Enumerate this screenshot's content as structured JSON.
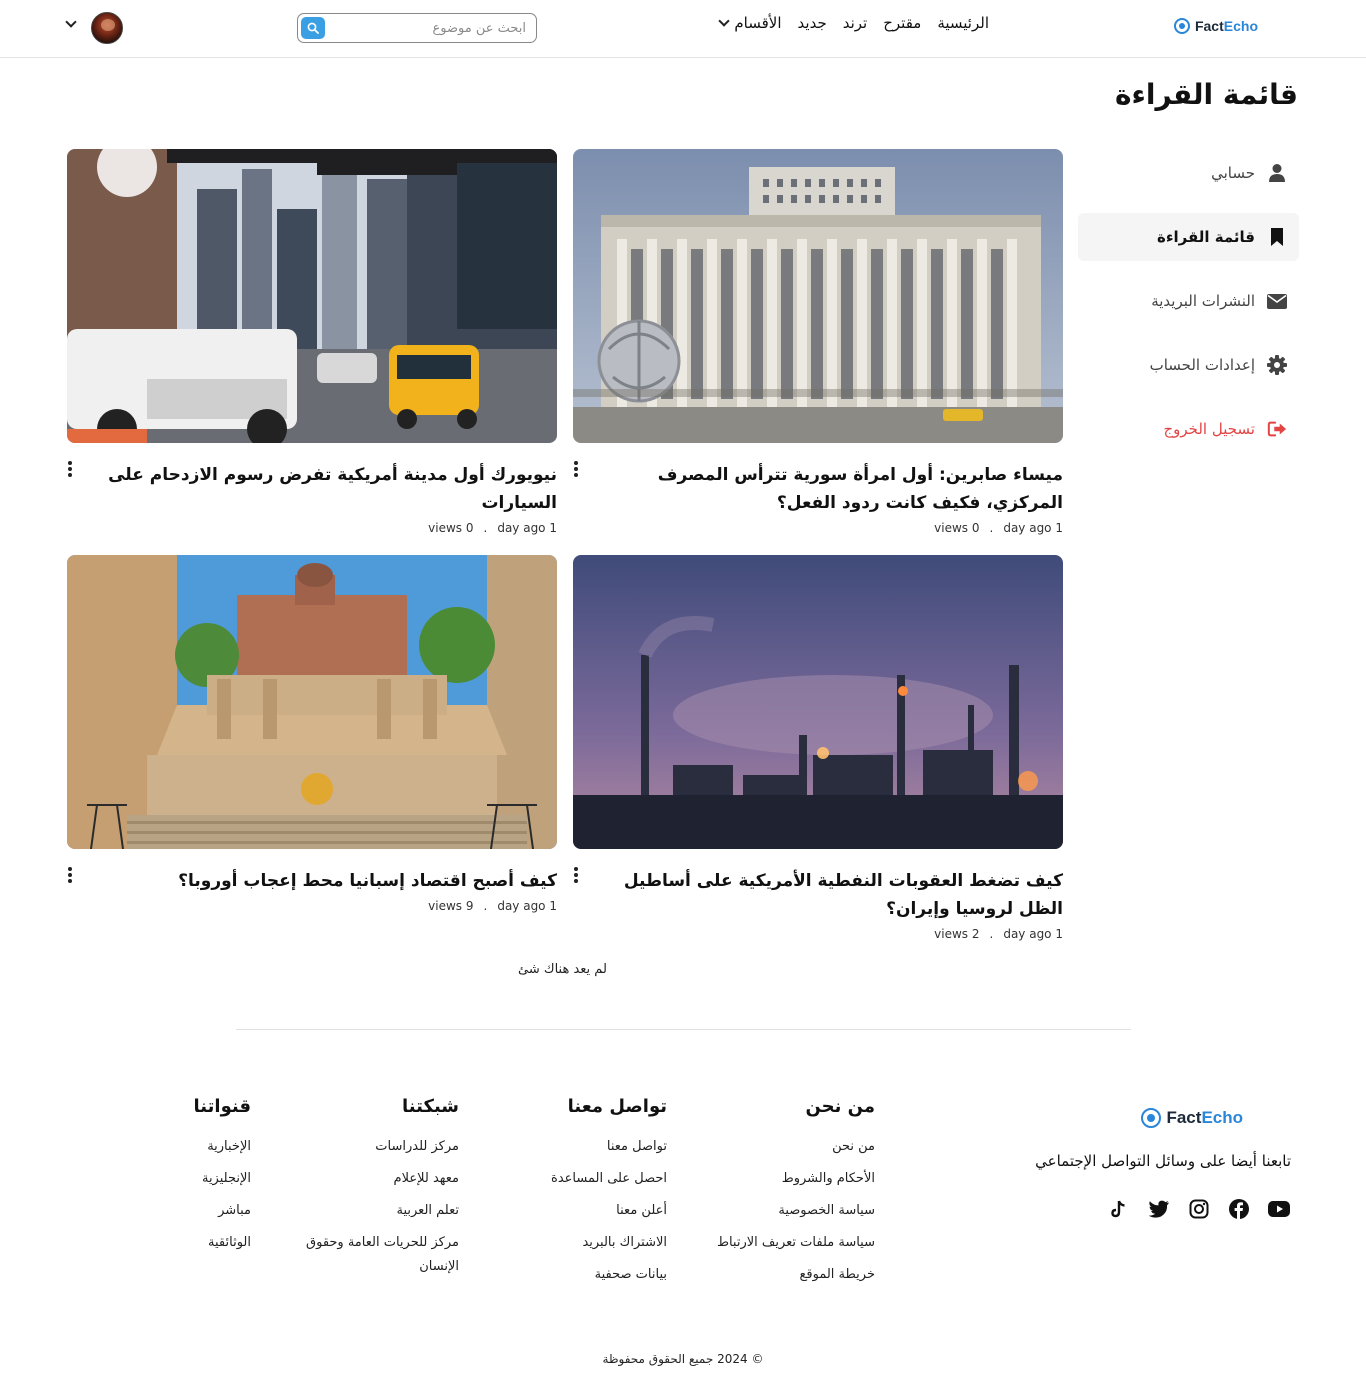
{
  "brand": {
    "part1": "Fact",
    "part2": "Echo",
    "color": "#2a86d9"
  },
  "nav": {
    "home": "الرئيسية",
    "suggested": "مقترح",
    "trending": "ترند",
    "new": "جديد",
    "categories": "الأقسام"
  },
  "search": {
    "placeholder": "ابحث عن موضوع",
    "icon": "search-icon"
  },
  "page": {
    "title": "قائمة القراءة"
  },
  "sidebar": {
    "items": [
      {
        "label": "حسابي",
        "icon": "user-icon"
      },
      {
        "label": "قائمة القراءة",
        "icon": "bookmark-icon",
        "active": true
      },
      {
        "label": "النشرات البريدية",
        "icon": "envelope-icon"
      },
      {
        "label": "إعدادات الحساب",
        "icon": "gear-icon"
      },
      {
        "label": "تسجيل الخروج",
        "icon": "sign-out-icon",
        "color": "#e24444"
      }
    ]
  },
  "articles": [
    {
      "title": "ميساء صابرين: أول امرأة سورية تترأس المصرف المركزي، فكيف كانت ردود الفعل؟",
      "views": "0 views",
      "time": "1 day ago",
      "image": "central-bank-building"
    },
    {
      "title": "نيويورك أول مدينة أمريكية تفرض رسوم الازدحام على السيارات",
      "views": "0 views",
      "time": "1 day ago",
      "image": "new-york-street-traffic"
    },
    {
      "title": "كيف تضغط العقوبات النفطية الأمريكية على أساطيل الظل لروسيا وإيران؟",
      "views": "2 views",
      "time": "1 day ago",
      "image": "oil-refinery-dusk"
    },
    {
      "title": "كيف أصبح اقتصاد إسبانيا محط إعجاب أوروبا؟",
      "views": "9 views",
      "time": "1 day ago",
      "image": "spanish-plaza-stairs"
    }
  ],
  "empty_note": "لم يعد هناك شئ",
  "footer": {
    "follow": "تابعنا أيضا على وسائل التواصل الإجتماعي",
    "socials": [
      "youtube-icon",
      "facebook-icon",
      "instagram-icon",
      "twitter-icon",
      "tiktok-icon"
    ],
    "about": {
      "title": "من نحن",
      "links": [
        "من نحن",
        "الأحكام والشروط",
        "سياسة الخصوصية",
        "سياسة ملفات تعريف الارتباط",
        "خريطة الموقع"
      ]
    },
    "contact": {
      "title": "تواصل معنا",
      "links": [
        "تواصل معنا",
        "احصل على المساعدة",
        "أعلن معنا",
        "الاشتراك بالبريد",
        "بيانات صحفية"
      ]
    },
    "network": {
      "title": "شبكتنا",
      "links": [
        "مركز للدراسات",
        "معهد للإعلام",
        "تعلم العربية",
        "مركز للحريات العامة وحقوق الإنسان"
      ]
    },
    "channels": {
      "title": "قنواتنا",
      "links": [
        "الإخبارية",
        "الإنجليزية",
        "مباشر",
        "الوثائقية"
      ]
    },
    "copyright": "© 2024 جميع الحقوق محفوظة"
  }
}
